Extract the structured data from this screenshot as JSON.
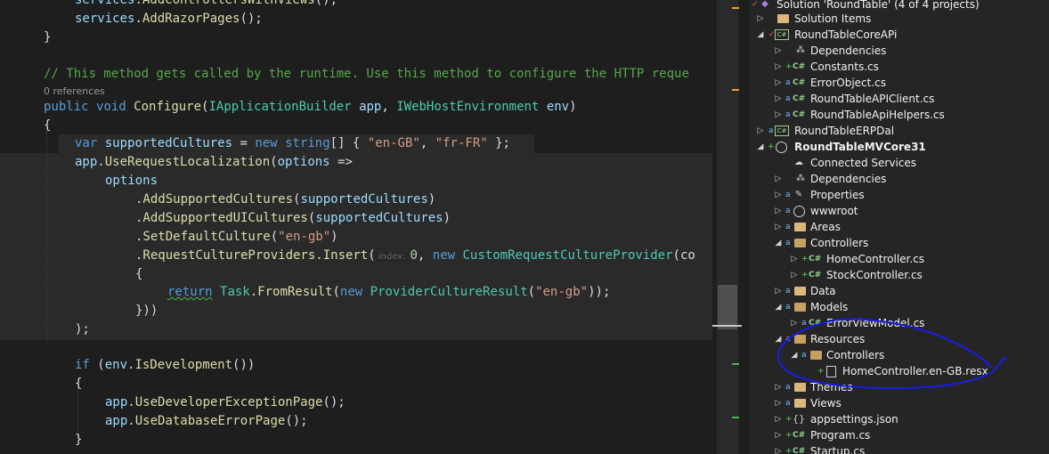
{
  "colors": {
    "editor_bg": "#1e1e1e",
    "panel_bg": "#252526",
    "keyword": "#569cd6",
    "type": "#4ec9b0",
    "method": "#dcdcaa",
    "string": "#d69d85",
    "comment": "#57a64a",
    "annotation": "#1a1ae8"
  },
  "editor": {
    "l1": {
      "a": "services",
      "b": ".",
      "c": "AddControllersWithViews",
      "d": "();"
    },
    "l2": {
      "a": "services",
      "b": ".",
      "c": "AddRazorPages",
      "d": "();"
    },
    "l3": "}",
    "comment": "// This method gets called by the runtime. Use this method to configure the HTTP reque",
    "codelens": "0 references",
    "sig": {
      "kw1": "public",
      "kw2": "void",
      "name": "Configure",
      "p1t": "IApplicationBuilder",
      "p1": "app",
      "p2t": "IWebHostEnvironment",
      "p2": "env"
    },
    "open_brace": "{",
    "cultures": {
      "kw": "var",
      "name": "supportedCultures",
      "eq": " = ",
      "kwnew": "new",
      "kwstr": "string",
      "br": "[] { ",
      "s1": "\"en-GB\"",
      "comma": ", ",
      "s2": "\"fr-FR\"",
      "end": " };"
    },
    "use": {
      "obj": "app",
      "m": "UseRequestLocalization",
      "p": "options",
      "arrow": " =>"
    },
    "options": "options",
    "add1": {
      "m": ".AddSupportedCultures",
      "a": "supportedCultures"
    },
    "add2": {
      "m": ".AddSupportedUICultures",
      "a": "supportedCultures"
    },
    "setdef": {
      "m": ".SetDefaultCulture",
      "s": "\"en-gb\""
    },
    "insert": {
      "m": ".RequestCultureProviders.Insert",
      "hint": "index:",
      "n": "0",
      "kw": "new",
      "cls": "CustomRequestCultureProvider",
      "tail": "(co"
    },
    "inner_open": "{",
    "ret": {
      "kw": "return",
      "t": "Task",
      "m": ".FromResult",
      "kw2": "new",
      "cls": "ProviderCultureResult",
      "s": "\"en-gb\"",
      "end": "));"
    },
    "inner_close": "}))",
    "stmt_end": ");",
    "ifline": {
      "kw": "if",
      "obj": "env",
      "m": ".IsDevelopment",
      "end": "())"
    },
    "if_open": "{",
    "dev1": {
      "obj": "app",
      "m": ".UseDeveloperExceptionPage",
      "end": "();"
    },
    "dev2": {
      "obj": "app",
      "m": ".UseDatabaseErrorPage",
      "end": "();"
    },
    "if_close": "}"
  },
  "solution": {
    "root": "Solution 'RoundTable' (4 of 4 projects)",
    "items": [
      {
        "label": "Solution Items"
      },
      {
        "label": "RoundTableCoreAPi"
      },
      {
        "label": "Dependencies"
      },
      {
        "label": "Constants.cs"
      },
      {
        "label": "ErrorObject.cs"
      },
      {
        "label": "RoundTableAPIClient.cs"
      },
      {
        "label": "RoundTableApiHelpers.cs"
      },
      {
        "label": "RoundTableERPDal"
      },
      {
        "label": "RoundTableMVCore31"
      },
      {
        "label": "Connected Services"
      },
      {
        "label": "Dependencies"
      },
      {
        "label": "Properties"
      },
      {
        "label": "wwwroot"
      },
      {
        "label": "Areas"
      },
      {
        "label": "Controllers"
      },
      {
        "label": "HomeController.cs"
      },
      {
        "label": "StockController.cs"
      },
      {
        "label": "Data"
      },
      {
        "label": "Models"
      },
      {
        "label": "ErrorViewModel.cs"
      },
      {
        "label": "Resources"
      },
      {
        "label": "Controllers"
      },
      {
        "label": "HomeController.en-GB.resx"
      },
      {
        "label": "Themes"
      },
      {
        "label": "Views"
      },
      {
        "label": "appsettings.json"
      },
      {
        "label": "Program.cs"
      },
      {
        "label": "Startup.cs"
      }
    ]
  }
}
